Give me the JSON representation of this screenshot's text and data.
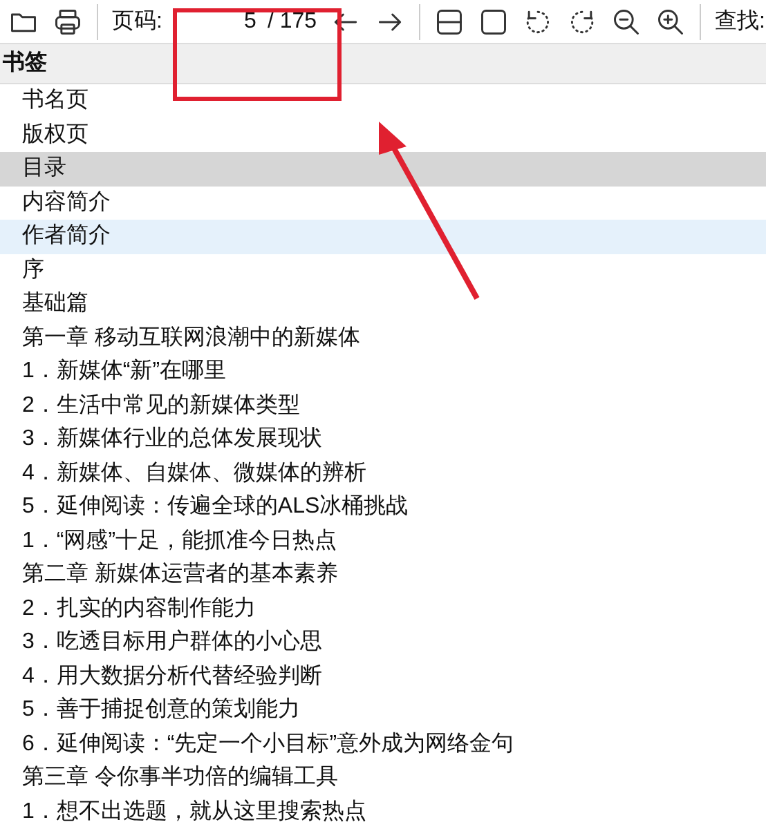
{
  "toolbar": {
    "page_label": "页码:",
    "page_value": "5",
    "page_total": "/ 175",
    "find_label": "查找:"
  },
  "bookmarks": {
    "title": "书签",
    "items": [
      {
        "label": "书名页",
        "selected": false,
        "hovered": false
      },
      {
        "label": "版权页",
        "selected": false,
        "hovered": false
      },
      {
        "label": "目录",
        "selected": true,
        "hovered": false
      },
      {
        "label": "内容简介",
        "selected": false,
        "hovered": false
      },
      {
        "label": "作者简介",
        "selected": false,
        "hovered": true
      },
      {
        "label": "序",
        "selected": false,
        "hovered": false
      },
      {
        "label": "基础篇",
        "selected": false,
        "hovered": false
      },
      {
        "label": "第一章 移动互联网浪潮中的新媒体",
        "selected": false,
        "hovered": false
      },
      {
        "label": "1．新媒体“新”在哪里",
        "selected": false,
        "hovered": false
      },
      {
        "label": "2．生活中常见的新媒体类型",
        "selected": false,
        "hovered": false
      },
      {
        "label": "3．新媒体行业的总体发展现状",
        "selected": false,
        "hovered": false
      },
      {
        "label": "4．新媒体、自媒体、微媒体的辨析",
        "selected": false,
        "hovered": false
      },
      {
        "label": "5．延伸阅读：传遍全球的ALS冰桶挑战",
        "selected": false,
        "hovered": false
      },
      {
        "label": "1．“网感”十足，能抓准今日热点",
        "selected": false,
        "hovered": false
      },
      {
        "label": "第二章 新媒体运营者的基本素养",
        "selected": false,
        "hovered": false
      },
      {
        "label": "2．扎实的内容制作能力",
        "selected": false,
        "hovered": false
      },
      {
        "label": "3．吃透目标用户群体的小心思",
        "selected": false,
        "hovered": false
      },
      {
        "label": "4．用大数据分析代替经验判断",
        "selected": false,
        "hovered": false
      },
      {
        "label": "5．善于捕捉创意的策划能力",
        "selected": false,
        "hovered": false
      },
      {
        "label": "6．延伸阅读：“先定一个小目标”意外成为网络金句",
        "selected": false,
        "hovered": false
      },
      {
        "label": "第三章 令你事半功倍的编辑工具",
        "selected": false,
        "hovered": false
      },
      {
        "label": "1．想不出选题，就从这里搜索热点",
        "selected": false,
        "hovered": false
      }
    ]
  }
}
